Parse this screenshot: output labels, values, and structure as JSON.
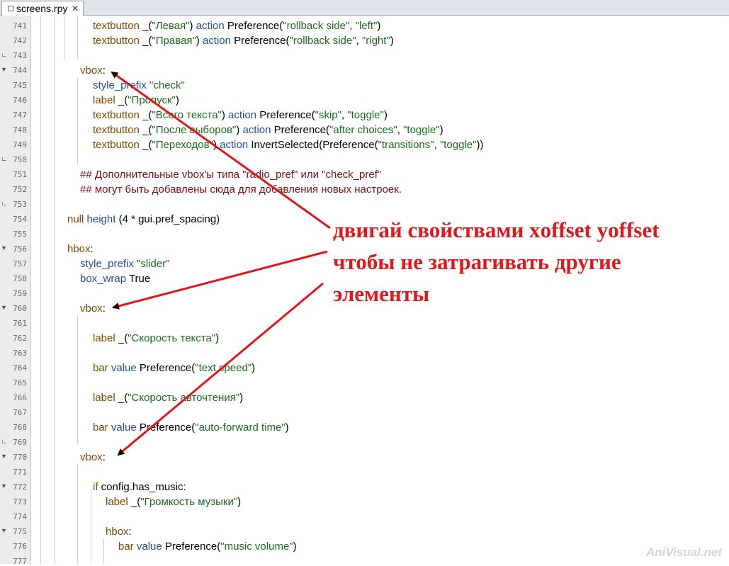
{
  "tab": {
    "label": "screens.rpy",
    "close": "✕"
  },
  "lines": [
    {
      "num": "741",
      "fold": "none",
      "indent": 2,
      "tokens": [
        [
          "kw",
          "textbutton"
        ],
        [
          "pl",
          " _("
        ],
        [
          "str",
          "\"Левая\""
        ],
        [
          "pl",
          ") "
        ],
        [
          "prop",
          "action"
        ],
        [
          "pl",
          " Preference("
        ],
        [
          "str",
          "\"rollback side\""
        ],
        [
          "pl",
          ", "
        ],
        [
          "str",
          "\"left\""
        ],
        [
          "pl",
          ")"
        ]
      ]
    },
    {
      "num": "742",
      "fold": "none",
      "indent": 2,
      "tokens": [
        [
          "kw",
          "textbutton"
        ],
        [
          "pl",
          " _("
        ],
        [
          "str",
          "\"Правая\""
        ],
        [
          "pl",
          ") "
        ],
        [
          "prop",
          "action"
        ],
        [
          "pl",
          " Preference("
        ],
        [
          "str",
          "\"rollback side\""
        ],
        [
          "pl",
          ", "
        ],
        [
          "str",
          "\"right\""
        ],
        [
          "pl",
          ")"
        ]
      ]
    },
    {
      "num": "743",
      "fold": "end",
      "indent": 0,
      "tokens": []
    },
    {
      "num": "744",
      "fold": "open",
      "indent": 1,
      "tokens": [
        [
          "kw",
          "vbox"
        ],
        [
          "pl",
          ":"
        ]
      ]
    },
    {
      "num": "745",
      "fold": "none",
      "indent": 2,
      "tokens": [
        [
          "prop",
          "style_prefix"
        ],
        [
          "pl",
          " "
        ],
        [
          "str",
          "\"check\""
        ]
      ]
    },
    {
      "num": "746",
      "fold": "none",
      "indent": 2,
      "tokens": [
        [
          "kw",
          "label"
        ],
        [
          "pl",
          " _("
        ],
        [
          "str",
          "\"Пропуск\""
        ],
        [
          "pl",
          ")"
        ]
      ]
    },
    {
      "num": "747",
      "fold": "none",
      "indent": 2,
      "tokens": [
        [
          "kw",
          "textbutton"
        ],
        [
          "pl",
          " _("
        ],
        [
          "str",
          "\"Всего текста\""
        ],
        [
          "pl",
          ") "
        ],
        [
          "prop",
          "action"
        ],
        [
          "pl",
          " Preference("
        ],
        [
          "str",
          "\"skip\""
        ],
        [
          "pl",
          ", "
        ],
        [
          "str",
          "\"toggle\""
        ],
        [
          "pl",
          ")"
        ]
      ]
    },
    {
      "num": "748",
      "fold": "none",
      "indent": 2,
      "tokens": [
        [
          "kw",
          "textbutton"
        ],
        [
          "pl",
          " _("
        ],
        [
          "str",
          "\"После выборов\""
        ],
        [
          "pl",
          ") "
        ],
        [
          "prop",
          "action"
        ],
        [
          "pl",
          " Preference("
        ],
        [
          "str",
          "\"after choices\""
        ],
        [
          "pl",
          ", "
        ],
        [
          "str",
          "\"toggle\""
        ],
        [
          "pl",
          ")"
        ]
      ]
    },
    {
      "num": "749",
      "fold": "none",
      "indent": 2,
      "tokens": [
        [
          "kw",
          "textbutton"
        ],
        [
          "pl",
          " _("
        ],
        [
          "str",
          "\"Переходов\""
        ],
        [
          "pl",
          ") "
        ],
        [
          "prop",
          "action"
        ],
        [
          "pl",
          " InvertSelected(Preference("
        ],
        [
          "str",
          "\"transitions\""
        ],
        [
          "pl",
          ", "
        ],
        [
          "str",
          "\"toggle\""
        ],
        [
          "pl",
          "))"
        ]
      ]
    },
    {
      "num": "750",
      "fold": "end",
      "indent": 0,
      "tokens": []
    },
    {
      "num": "751",
      "fold": "none",
      "indent": 1,
      "tokens": [
        [
          "cmt",
          "## Дополнительные vbox'ы типа \"radio_pref\" или \"check_pref\""
        ]
      ]
    },
    {
      "num": "752",
      "fold": "none",
      "indent": 1,
      "tokens": [
        [
          "cmt",
          "## могут быть добавлены сюда для добавления новых настроек."
        ]
      ]
    },
    {
      "num": "753",
      "fold": "end",
      "indent": 0,
      "tokens": []
    },
    {
      "num": "754",
      "fold": "none",
      "indent": 0,
      "tokens": [
        [
          "kw",
          "null"
        ],
        [
          "pl",
          " "
        ],
        [
          "prop",
          "height"
        ],
        [
          "pl",
          " (4 * gui.pref_spacing)"
        ]
      ]
    },
    {
      "num": "755",
      "fold": "none",
      "indent": 0,
      "tokens": []
    },
    {
      "num": "756",
      "fold": "open",
      "indent": 0,
      "tokens": [
        [
          "kw",
          "hbox"
        ],
        [
          "pl",
          ":"
        ]
      ]
    },
    {
      "num": "757",
      "fold": "none",
      "indent": 1,
      "tokens": [
        [
          "prop",
          "style_prefix"
        ],
        [
          "pl",
          " "
        ],
        [
          "str",
          "\"slider\""
        ]
      ]
    },
    {
      "num": "758",
      "fold": "none",
      "indent": 1,
      "tokens": [
        [
          "prop",
          "box_wrap"
        ],
        [
          "pl",
          " True"
        ]
      ]
    },
    {
      "num": "759",
      "fold": "none",
      "indent": 0,
      "tokens": []
    },
    {
      "num": "760",
      "fold": "open",
      "indent": 1,
      "tokens": [
        [
          "kw",
          "vbox"
        ],
        [
          "pl",
          ":"
        ]
      ]
    },
    {
      "num": "761",
      "fold": "none",
      "indent": 0,
      "tokens": []
    },
    {
      "num": "762",
      "fold": "none",
      "indent": 2,
      "tokens": [
        [
          "kw",
          "label"
        ],
        [
          "pl",
          " _("
        ],
        [
          "str",
          "\"Скорость текста\""
        ],
        [
          "pl",
          ")"
        ]
      ]
    },
    {
      "num": "763",
      "fold": "none",
      "indent": 0,
      "tokens": []
    },
    {
      "num": "764",
      "fold": "none",
      "indent": 2,
      "tokens": [
        [
          "kw",
          "bar"
        ],
        [
          "pl",
          " "
        ],
        [
          "prop",
          "value"
        ],
        [
          "pl",
          " Preference("
        ],
        [
          "str",
          "\"text speed\""
        ],
        [
          "pl",
          ")"
        ]
      ]
    },
    {
      "num": "765",
      "fold": "none",
      "indent": 0,
      "tokens": []
    },
    {
      "num": "766",
      "fold": "none",
      "indent": 2,
      "tokens": [
        [
          "kw",
          "label"
        ],
        [
          "pl",
          " _("
        ],
        [
          "str",
          "\"Скорость авточтения\""
        ],
        [
          "pl",
          ")"
        ]
      ]
    },
    {
      "num": "767",
      "fold": "none",
      "indent": 0,
      "tokens": []
    },
    {
      "num": "768",
      "fold": "none",
      "indent": 2,
      "tokens": [
        [
          "kw",
          "bar"
        ],
        [
          "pl",
          " "
        ],
        [
          "prop",
          "value"
        ],
        [
          "pl",
          " Preference("
        ],
        [
          "str",
          "\"auto-forward time\""
        ],
        [
          "pl",
          ")"
        ]
      ]
    },
    {
      "num": "769",
      "fold": "end",
      "indent": 0,
      "tokens": []
    },
    {
      "num": "770",
      "fold": "open",
      "indent": 1,
      "tokens": [
        [
          "kw",
          "vbox"
        ],
        [
          "pl",
          ":"
        ]
      ]
    },
    {
      "num": "771",
      "fold": "none",
      "indent": 0,
      "tokens": []
    },
    {
      "num": "772",
      "fold": "open",
      "indent": 2,
      "tokens": [
        [
          "kw",
          "if"
        ],
        [
          "pl",
          " config.has_music:"
        ]
      ]
    },
    {
      "num": "773",
      "fold": "none",
      "indent": 3,
      "tokens": [
        [
          "kw",
          "label"
        ],
        [
          "pl",
          " _("
        ],
        [
          "str",
          "\"Громкость музыки\""
        ],
        [
          "pl",
          ")"
        ]
      ]
    },
    {
      "num": "774",
      "fold": "none",
      "indent": 0,
      "tokens": []
    },
    {
      "num": "775",
      "fold": "open",
      "indent": 3,
      "tokens": [
        [
          "kw",
          "hbox"
        ],
        [
          "pl",
          ":"
        ]
      ]
    },
    {
      "num": "776",
      "fold": "none",
      "indent": 4,
      "tokens": [
        [
          "kw",
          "bar"
        ],
        [
          "pl",
          " "
        ],
        [
          "prop",
          "value"
        ],
        [
          "pl",
          " Preference("
        ],
        [
          "str",
          "\"music volume\""
        ],
        [
          "pl",
          ")"
        ]
      ]
    },
    {
      "num": "777",
      "fold": "none",
      "indent": 0,
      "tokens": []
    }
  ],
  "annotation": {
    "line1": "двигай свойствами xoffset yoffset",
    "line2": "чтобы не затрагивать другие",
    "line3": "элементы",
    "color": "#e2171b"
  },
  "watermark": "AniVisual.net",
  "colors": {
    "keyword": "#7a4a00",
    "property": "#1f4e9a",
    "string": "#1d6a1d",
    "comment": "#7a1010"
  }
}
